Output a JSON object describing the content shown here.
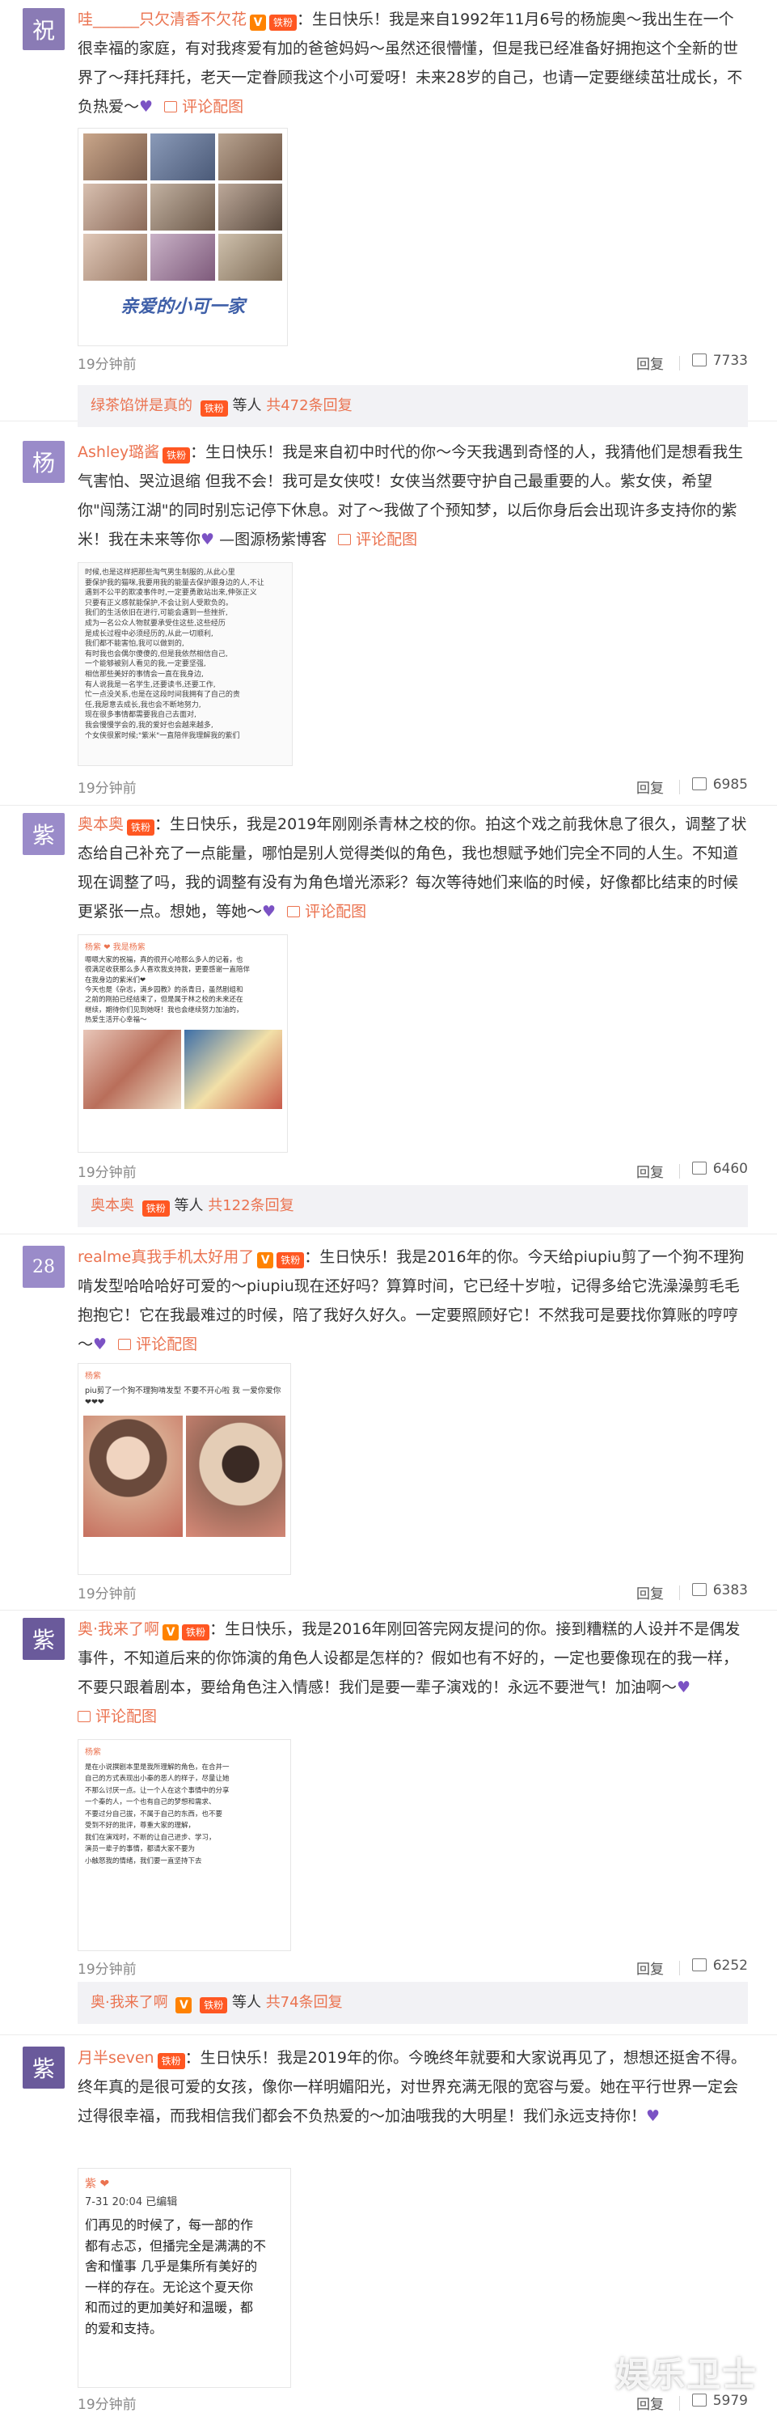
{
  "colors": {
    "username": "#eb7350",
    "heart": "#7b52c4",
    "vip": "#ff8200",
    "summary_bg": "#f2f2f5"
  },
  "labels": {
    "reply": "回复",
    "pic_attach": "评论配图",
    "fan_badge": "铁粉",
    "vip": "V"
  },
  "comments": [
    {
      "avatar_char": "祝",
      "avatar_color": "#8a7bb5",
      "user": "哇______只欠清香不欠花",
      "text": "：生日快乐！我是来自1992年11月6号的杨旎奥～我出生在一个很幸福的家庭，有对我疼爱有加的爸爸妈妈～虽然还很懵懂，但是我已经准备好拥抱这个全新的世界了～拜托拜托，老天一定眷顾我这个小可爱呀！未来28岁的自己，也请一定要继续茁壮成长，不负热爱～",
      "time": "19分钟前",
      "likes": "7733",
      "image_caption": "亲爱的小可一家"
    },
    {
      "avatar_char": "杨",
      "avatar_color": "#9a8bc9",
      "user": "Ashley璐酱",
      "text": "：生日快乐！我是来自初中时代的你～今天我遇到奇怪的人，我猜他们是想看我生气害怕、哭泣退缩 但我不会！我可是女侠哎！女侠当然要守护自己最重要的人。紫女侠，希望你\"闯荡江湖\"的同时别忘记停下休息。对了～我做了个预知梦，以后你身后会出现许多支持你的紫米！我在未来等你",
      "text_after": " —图源杨紫博客",
      "time": "19分钟前",
      "likes": "6985",
      "image_lines": [
        "时候,也是这样把那些淘气男生制服的,从此心里",
        "要保护我的猫咪,我要用我的能量去保护跟身边的人,不让",
        "遇到不公平的欺凌事件时,一定要勇敢站出来,伸张正义",
        "只要有正义感就能保护,不会让别人受欺负的。",
        "我们的生活依旧在进行,可能会遇到一些挫折,",
        "成为一名公众人物就要承受住这些,这些经历",
        "是成长过程中必须经历的,从此一切顺利,",
        "我们都不能害怕,我可以做到的,",
        "有时我也会偶尔傻傻的,但是我依然相信自己,",
        "一个能够被别人看见的我,一定要坚强,",
        "相信那些美好的事情会一直在我身边,",
        "有人说我是一名学生,还要读书,还要工作,",
        "忙一点没关系,也是在这段时间我拥有了自己的责",
        "任,我愿意去成长,我也会不断地努力,",
        "现在很多事情都需要我自己去面对,",
        "我会慢慢学会的,我的爱好也会越来越多,",
        "个女侠很累时候;\"紫米\"一直陪伴我理解我的紫们"
      ]
    },
    {
      "avatar_char": "紫",
      "avatar_color": "#9a8bc9",
      "user": "奥本奥",
      "text": "：生日快乐，我是2019年刚刚杀青林之校的你。拍这个戏之前我休息了很久，调整了状态给自己补充了一点能量，哪怕是别人觉得类似的角色，我也想赋予她们完全不同的人生。不知道现在调整了吗，我的调整有没有为角色增光添彩？每次等待她们来临的时候，好像都比结束的时候更紧张一点。想她，等她～",
      "time": "19分钟前",
      "likes": "6460",
      "image_post_user": "杨紫 ❤ 我是杨紫",
      "image_lines": [
        "嗯嗯大家的祝福，真的很开心哈那么多人的记着，也",
        "很满足收获那么多人喜欢我支持我，更要感谢一直陪伴",
        "在我身边的紫米们❤",
        "今天也是《杂志，满乡园教》的杀青日，虽然剧组和",
        "之前的刚拍已经结束了，但是属于林之校的未来还在",
        "继续，期待你们见到她呀！我也会继续努力加油的，",
        "热爱生活开心幸福～"
      ],
      "summary": {
        "user": "奥本奥",
        "rest": "等人",
        "total": "共122条回复"
      }
    },
    {
      "avatar_char": "28",
      "avatar_color": "#9a8bc9",
      "user": "realme真我手机太好用了",
      "text": "：生日快乐！我是2016年的你。今天给piupiu剪了一个狗不理狗啃发型哈哈哈好可爱的～piupiu现在还好吗？算算时间，它已经十岁啦，记得多给它洗澡澡剪毛毛抱抱它！它在我最难过的时候，陪了我好久好久。一定要照顾好它！不然我可是要找你算账的哼哼～",
      "time": "19分钟前",
      "likes": "6383",
      "image_post_user": "杨紫",
      "image_post_caption": "piu剪了一个狗不理狗啃发型 不要不开心啦 我 一爱你爱你❤❤❤"
    },
    {
      "avatar_char": "紫",
      "avatar_color": "#6a5a9b",
      "user": "奥·我来了啊",
      "text": "：生日快乐，我是2016年刚回答完网友提问的你。接到糟糕的人设并不是偶发事件，不知道后来的你饰演的角色人设都是怎样的？假如也有不好的，一定也要像现在的我一样，不要只跟着剧本，要给角色注入情感！我们是要一辈子演戏的！永远不要泄气！加油啊～",
      "time": "19分钟前",
      "likes": "6252",
      "image_post_user": "杨紫",
      "image_lines": [
        "是在小说撰剧本里是我所理解的角色，在合并一",
        "自己的方式表现出小秦的恶人的样子，尽量让她",
        "不那么讨厌一点。让一个人在这个事情中的分享",
        "一个秦的人，一个也有自己的梦想和需求、",
        "不要过分自己拔，不属于自己的东西，也不要",
        "受到不好的批评，尊重大家的理解，",
        "我们在演戏时，不断的让自己进步、学习，",
        "演员一辈子的事情，都请大家不要为",
        "小触怒我的情绪，我们要一直坚持下去"
      ],
      "summary": {
        "user": "奥·我来了啊",
        "rest": "等人",
        "total": "共74条回复"
      }
    },
    {
      "avatar_char": "紫",
      "avatar_color": "#6a5a9b",
      "user": "月半seven",
      "text": "：生日快乐！我是2019年的你。今晚终年就要和大家说再见了，想想还挺舍不得。终年真的是很可爱的女孩，像你一样明媚阳光，对世界充满无限的宽容与爱。她在平行世界一定会过得很幸福，而我相信我们都会不负热爱的～加油哦我的大明星！我们永远支持你！",
      "time": "19分钟前",
      "likes": "5979",
      "image_post_user": "紫 ❤",
      "image_post_time": "7-31 20:04  已编辑",
      "image_lines": [
        "们再见的时候了，每一部的作",
        "都有忐忑，但播完全是满满的不",
        "舍和懂事 几乎是集所有美好的",
        "一样的存在。无论这个夏天你",
        "和而过的更加美好和温暖，都",
        "的爱和支持。"
      ],
      "watermark": "娱乐卫士"
    }
  ],
  "summary_first": {
    "user": "绿茶馅饼是真的",
    "rest": "等人",
    "total": "共472条回复"
  }
}
